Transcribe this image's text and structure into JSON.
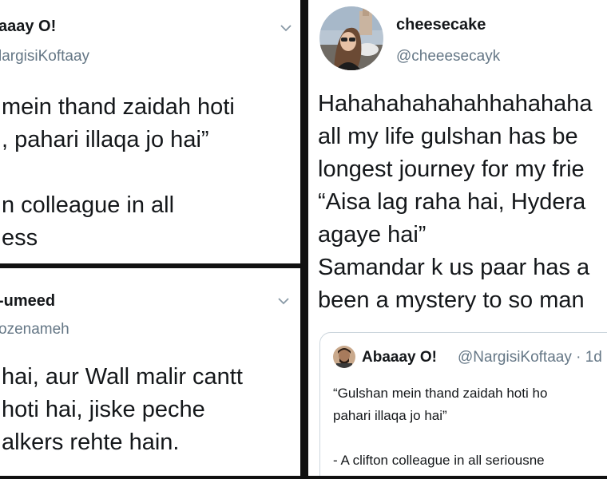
{
  "tweet_top_left": {
    "name": "aaay O!",
    "handle": "largisiKoftaay",
    "lines": [
      "mein thand zaidah hoti",
      ", pahari illaqa jo hai”",
      "",
      "n colleague in all",
      "ess"
    ]
  },
  "tweet_bottom_left": {
    "name": "-umeed",
    "handle": "ozenameh",
    "lines": [
      "hai, aur Wall malir cantt",
      "hoti hai, jiske peche",
      "alkers rehte hain."
    ]
  },
  "tweet_right": {
    "name": "cheesecake",
    "handle": "@cheeesecayk",
    "lines": [
      "Hahahahahahahhahahaha",
      "all my life gulshan has be",
      "longest journey for my frie",
      "“Aisa lag raha hai, Hydera",
      "agaye hai”",
      "Samandar k us paar has a",
      "been a mystery to so man"
    ],
    "quoted": {
      "name": "Abaaay O!",
      "handle_time": "@NargisiKoftaay · 1d",
      "lines": [
        "“Gulshan mein thand zaidah hoti ho",
        "pahari illaqa jo hai”",
        "",
        "- A clifton colleague in all seriousne"
      ]
    }
  },
  "colors": {
    "text": "#14171a",
    "handle": "#657786",
    "border": "#ccd6dd",
    "divider": "#111111"
  },
  "icons": {
    "caret": "chevron-down-icon"
  }
}
